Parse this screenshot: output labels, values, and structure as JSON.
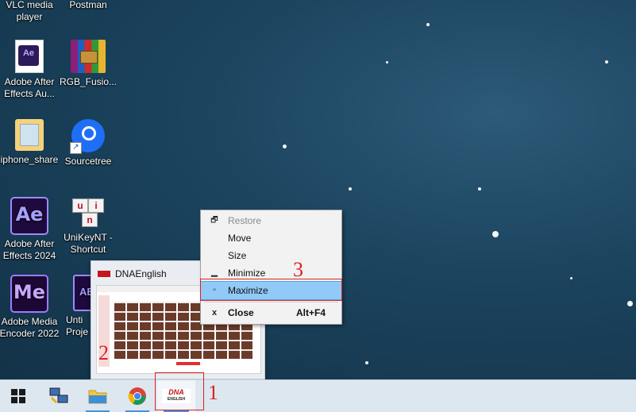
{
  "desktop_icons": [
    {
      "label": "VLC media player"
    },
    {
      "label": "Postman"
    },
    {
      "label": "Adobe After Effects Au...",
      "badge": "Ae"
    },
    {
      "label": "RGB_Fusio..."
    },
    {
      "label": "iphone_share"
    },
    {
      "label": "Sourcetree"
    },
    {
      "label": "Adobe After Effects 2024",
      "badge": "Ae"
    },
    {
      "label": "UniKeyNT - Shortcut",
      "keys": [
        "u",
        "i",
        "n"
      ]
    },
    {
      "label": "Adobe Media Encoder 2022",
      "badge": "Me"
    },
    {
      "label_line1": "Unti",
      "label_line2": "Proje",
      "badge": "AE"
    }
  ],
  "thumbnail": {
    "title": "DNAEnglish"
  },
  "context_menu": {
    "items": [
      {
        "label": "Restore",
        "disabled": true
      },
      {
        "label": "Move"
      },
      {
        "label": "Size"
      },
      {
        "label": "Minimize"
      },
      {
        "label": "Maximize",
        "highlighted": true
      },
      {
        "label": "Close",
        "accelerator": "Alt+F4",
        "bold": true
      }
    ]
  },
  "taskbar": {
    "dna_logo_top": "DNA",
    "dna_logo_bottom": "ENGLISH"
  },
  "annotations": {
    "step1": "1",
    "step2": "2",
    "step3": "3"
  },
  "colors": {
    "annotation_red": "#e02020",
    "menu_highlight": "#91c9f7",
    "taskbar": "#dde7f0"
  }
}
